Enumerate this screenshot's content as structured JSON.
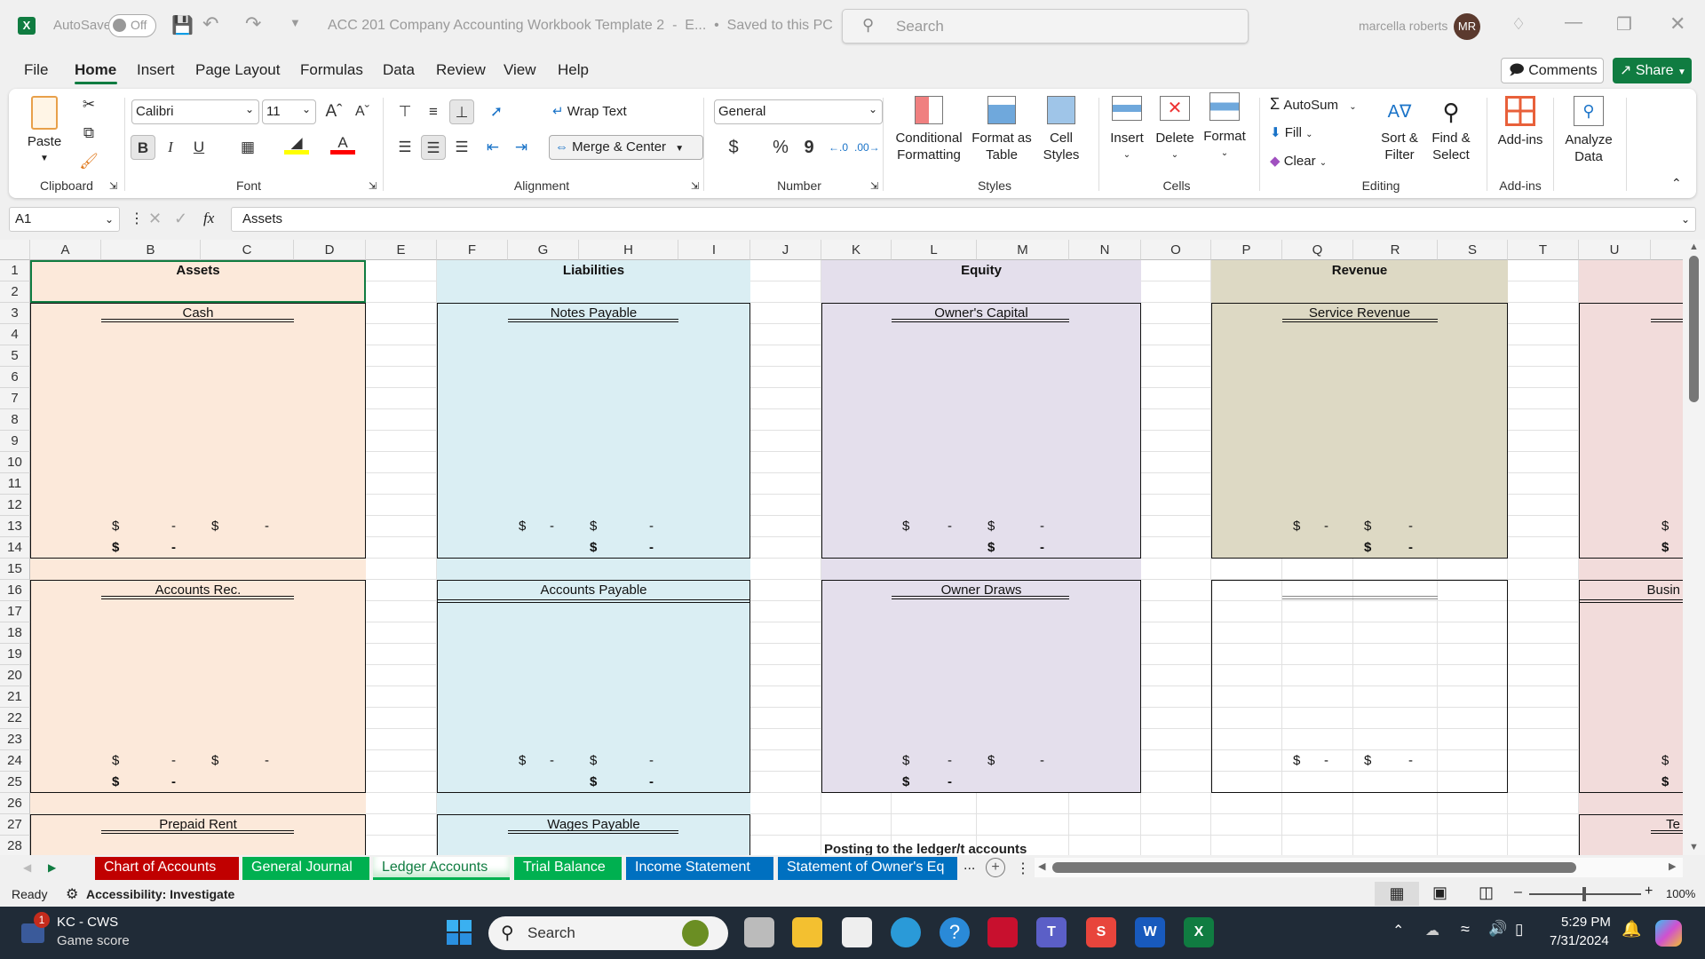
{
  "titlebar": {
    "autosave_label": "AutoSave",
    "autosave_state": "Off",
    "doc_title": "ACC 201 Company Accounting Workbook Template 2  -  E...  •  Saved to this PC",
    "search_placeholder": "Search",
    "user_name": "marcella roberts",
    "user_initials": "MR",
    "avatar_color": "#5b3a2e"
  },
  "menu": {
    "tabs": [
      "File",
      "Home",
      "Insert",
      "Page Layout",
      "Formulas",
      "Data",
      "Review",
      "View",
      "Help"
    ],
    "active": "Home",
    "comments_label": "Comments",
    "share_label": "Share",
    "share_color": "#107c41"
  },
  "ribbon": {
    "clipboard": {
      "paste": "Paste",
      "label": "Clipboard"
    },
    "font": {
      "name": "Calibri",
      "size": "11",
      "label": "Font",
      "bold": "B",
      "italic": "I",
      "underline": "U",
      "highlight_color": "#ffff00",
      "font_color": "#ff0000"
    },
    "alignment": {
      "wrap_text": "Wrap Text",
      "merge_center": "Merge & Center",
      "label": "Alignment"
    },
    "number": {
      "format": "General",
      "label": "Number",
      "currency": "$",
      "percent": "%",
      "comma": "9"
    },
    "styles": {
      "conditional": [
        "Conditional",
        "Formatting"
      ],
      "format_table": [
        "Format as",
        "Table"
      ],
      "cell_styles": [
        "Cell",
        "Styles"
      ],
      "label": "Styles"
    },
    "cells": {
      "insert": "Insert",
      "delete": "Delete",
      "format": "Format",
      "label": "Cells"
    },
    "editing": {
      "autosum": "AutoSum",
      "fill": "Fill",
      "clear": "Clear",
      "sort": [
        "Sort &",
        "Filter"
      ],
      "find": [
        "Find &",
        "Select"
      ],
      "label": "Editing"
    },
    "addins": {
      "addins": "Add-ins",
      "label": "Add-ins"
    },
    "analyze": [
      "Analyze",
      "Data"
    ]
  },
  "formula_bar": {
    "name_box": "A1",
    "fx": "fx",
    "content": "Assets"
  },
  "sheet": {
    "columns": [
      "A",
      "B",
      "C",
      "D",
      "E",
      "F",
      "G",
      "H",
      "I",
      "J",
      "K",
      "L",
      "M",
      "N",
      "O",
      "P",
      "Q",
      "R",
      "S",
      "T",
      "U"
    ],
    "rows": [
      "1",
      "2",
      "3",
      "4",
      "5",
      "6",
      "7",
      "8",
      "9",
      "10",
      "11",
      "12",
      "13",
      "14",
      "15",
      "16",
      "17",
      "18",
      "19",
      "20",
      "21",
      "22",
      "23",
      "24",
      "25",
      "26",
      "27",
      "28"
    ],
    "fills": [
      {
        "range": "A1:D28",
        "color": "#fce9da"
      },
      {
        "range": "F1:I28",
        "color": "#daeef3"
      },
      {
        "range": "K1:N25",
        "color": "#e4dfec"
      },
      {
        "range": "P1:S14",
        "color": "#ddd9c4"
      },
      {
        "range": "U1:V28",
        "color": "#f2dcdb"
      }
    ],
    "groups": [
      {
        "label": "Assets",
        "range": "A1:D1"
      },
      {
        "label": "Liabilities",
        "range": "F1:I1"
      },
      {
        "label": "Equity",
        "range": "K1:N1"
      },
      {
        "label": "Revenue",
        "range": "P1:S1"
      }
    ],
    "accounts": [
      {
        "title": "Cash",
        "range": "A3:D14",
        "underline": "B3:C3"
      },
      {
        "title": "Accounts Rec.",
        "range": "A16:D25",
        "underline": "B16:C16"
      },
      {
        "title": "Prepaid Rent",
        "range": "A27:D29",
        "underline": "B27:C27"
      },
      {
        "title": "Notes Payable",
        "range": "F3:I14",
        "underline": "G3:H3"
      },
      {
        "title": "Accounts Payable",
        "range": "F16:I25",
        "underline": "F16:I16",
        "boxed": true
      },
      {
        "title": "Wages Payable",
        "range": "F27:I29",
        "underline": "G27:H27"
      },
      {
        "title": "Owner's Capital",
        "range": "K3:N14",
        "underline": "L3:M3"
      },
      {
        "title": "Owner Draws",
        "range": "K16:N25",
        "underline": "L16:M16"
      },
      {
        "title": "Service Revenue",
        "range": "P3:S14",
        "underline": "Q3:R3"
      },
      {
        "title": "",
        "range": "P16:S25",
        "underline": "Q16:R16",
        "muted": true
      },
      {
        "title": "",
        "range": "U3:W14",
        "underline": "V3:W3",
        "align": "right"
      },
      {
        "title": "Busin",
        "range": "U16:W25",
        "underline": "U16:W16",
        "boxed": true,
        "align": "right"
      },
      {
        "title": "Te",
        "range": "U27:W29",
        "underline": "V27:W27",
        "align": "right"
      }
    ],
    "values": [
      {
        "ref": "B13",
        "sym": "$",
        "amt": "-"
      },
      {
        "ref": "C13",
        "sym": "$",
        "amt": "-"
      },
      {
        "ref": "B14",
        "sym": "$",
        "amt": "-",
        "total": true
      },
      {
        "ref": "G13",
        "sym": "$",
        "amt": "-"
      },
      {
        "ref": "H13",
        "sym": "$",
        "amt": "-"
      },
      {
        "ref": "H14",
        "sym": "$",
        "amt": "-",
        "total": true
      },
      {
        "ref": "L13",
        "sym": "$",
        "amt": "-"
      },
      {
        "ref": "M13",
        "sym": "$",
        "amt": "-"
      },
      {
        "ref": "M14",
        "sym": "$",
        "amt": "-",
        "total": true
      },
      {
        "ref": "Q13",
        "sym": "$",
        "amt": "-"
      },
      {
        "ref": "R13",
        "sym": "$",
        "amt": "-"
      },
      {
        "ref": "R14",
        "sym": "$",
        "amt": "-",
        "total": true
      },
      {
        "ref": "V13",
        "sym": "$",
        "amt": ""
      },
      {
        "ref": "V14",
        "sym": "$",
        "amt": "",
        "total": true
      },
      {
        "ref": "B24",
        "sym": "$",
        "amt": "-"
      },
      {
        "ref": "C24",
        "sym": "$",
        "amt": "-"
      },
      {
        "ref": "B25",
        "sym": "$",
        "amt": "-",
        "total": true
      },
      {
        "ref": "G24",
        "sym": "$",
        "amt": "-"
      },
      {
        "ref": "H24",
        "sym": "$",
        "amt": "-"
      },
      {
        "ref": "H25",
        "sym": "$",
        "amt": "-",
        "total": true
      },
      {
        "ref": "L24",
        "sym": "$",
        "amt": "-"
      },
      {
        "ref": "M24",
        "sym": "$",
        "amt": "-"
      },
      {
        "ref": "L25",
        "sym": "$",
        "amt": "-",
        "total": true
      },
      {
        "ref": "Q24",
        "sym": "$",
        "amt": "-"
      },
      {
        "ref": "R24",
        "sym": "$",
        "amt": "-"
      },
      {
        "ref": "V24",
        "sym": "$",
        "amt": ""
      },
      {
        "ref": "V25",
        "sym": "$",
        "amt": "",
        "total": true
      }
    ],
    "notes": [
      {
        "ref": "K28",
        "text": "Posting to the ledger/t accounts"
      }
    ]
  },
  "sheet_tabs": [
    {
      "label": "Chart of Accounts",
      "color": "#c00000"
    },
    {
      "label": "General Journal",
      "color": "#00b050"
    },
    {
      "label": "Ledger Accounts",
      "color": "#00b050",
      "active": true
    },
    {
      "label": "Trial Balance",
      "color": "#00b050"
    },
    {
      "label": "Income Statement",
      "color": "#0070c0"
    },
    {
      "label": "Statement of Owner's Eq",
      "color": "#0070c0"
    }
  ],
  "tabs_overflow": "...",
  "statusbar": {
    "ready": "Ready",
    "accessibility": "Accessibility: Investigate",
    "zoom": "100%",
    "zoom_level": 100
  },
  "taskbar": {
    "widget_title": "KC - CWS",
    "widget_subtitle": "Game score",
    "widget_badge": "1",
    "search": "Search",
    "time": "5:29 PM",
    "date": "7/31/2024",
    "apps": [
      "task-view",
      "file-explorer",
      "microsoft-store",
      "edge",
      "help",
      "mcafee",
      "teams",
      "snagit",
      "word",
      "excel"
    ]
  }
}
